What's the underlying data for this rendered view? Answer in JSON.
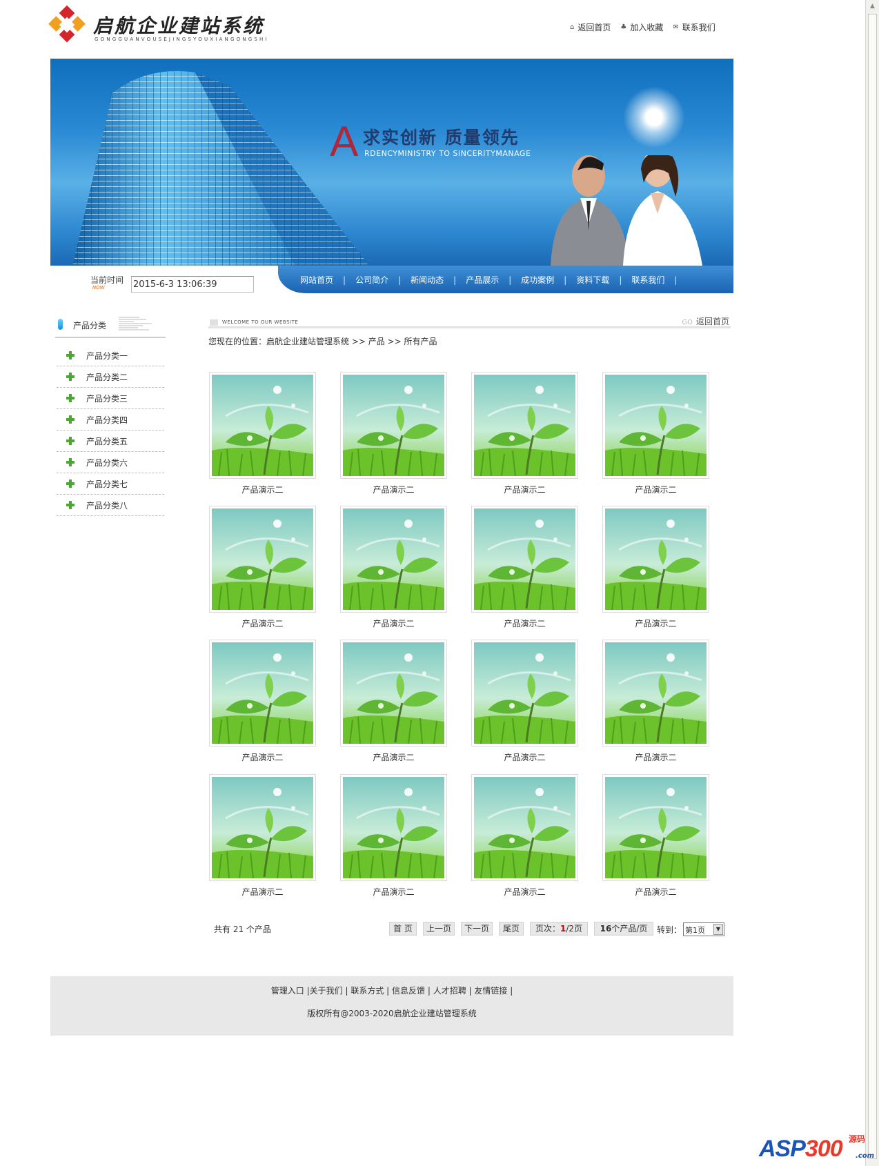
{
  "header": {
    "logo_title": "启航企业建站系统",
    "logo_subtitle": "GONGGUANVOUSEJINGSYOUXIANGONGSHI",
    "top_links": [
      {
        "label": "返回首页",
        "icon": "home-icon"
      },
      {
        "label": "加入收藏",
        "icon": "favorite-icon"
      },
      {
        "label": "联系我们",
        "icon": "mail-icon"
      }
    ]
  },
  "banner": {
    "letter": "A",
    "slogan": "求实创新  质量领先",
    "slogan_en": "RDENCYMINISTRY TO SINCERITYMANAGE"
  },
  "time": {
    "label": "当前时间",
    "now": "NOW",
    "value": "2015-6-3 13:06:39"
  },
  "nav": {
    "items": [
      "网站首页",
      "公司简介",
      "新闻动态",
      "产品展示",
      "成功案例",
      "资料下载",
      "联系我们"
    ]
  },
  "sidebar": {
    "title": "产品分类",
    "items": [
      "产品分类一",
      "产品分类二",
      "产品分类三",
      "产品分类四",
      "产品分类五",
      "产品分类六",
      "产品分类七",
      "产品分类八"
    ]
  },
  "main": {
    "welcome": "WELCOME TO OUR WEBSITE",
    "go": "GO",
    "back_label": "返回首页",
    "breadcrumb": "您现在的位置：启航企业建站管理系统 >> 产品 >> 所有产品",
    "products": [
      "产品演示二",
      "产品演示二",
      "产品演示二",
      "产品演示二",
      "产品演示二",
      "产品演示二",
      "产品演示二",
      "产品演示二",
      "产品演示二",
      "产品演示二",
      "产品演示二",
      "产品演示二",
      "产品演示二",
      "产品演示二",
      "产品演示二",
      "产品演示二"
    ]
  },
  "pager": {
    "total": "共有  21 个产品",
    "first": "首 页",
    "prev": "上一页",
    "next": "下一页",
    "last": "尾页",
    "page_prefix": "页次：",
    "page_current": "1",
    "page_total": "/2页",
    "per_page_num": "16",
    "per_page_suffix": "个产品/页",
    "goto_label": "转到：",
    "goto_value": "第1页"
  },
  "footer": {
    "links": [
      "管理入口",
      "关于我们",
      "联系方式",
      "信息反馈",
      "人才招聘",
      "友情链接"
    ],
    "copyright": "版权所有@2003-2020启航企业建站管理系统"
  },
  "watermark": {
    "brand_a": "ASP",
    "brand_b": "300",
    "tag": "源码",
    "domain": ".com"
  },
  "colors": {
    "nav_blue": "#1b63b2",
    "accent_red": "#b0263a",
    "plus_green": "#4aa832"
  }
}
